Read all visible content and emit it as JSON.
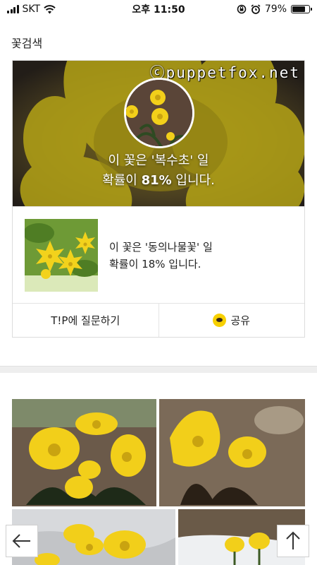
{
  "status_bar": {
    "carrier": "SKT",
    "time": "오후 11:50",
    "battery": "79%",
    "battery_level": 0.79
  },
  "header": {
    "title": "꽃검색"
  },
  "result": {
    "watermark": "ⓒpuppetfox.net",
    "top_line1_prefix": "이 꽃은 '",
    "top_name": "복수초",
    "top_line1_suffix": "' 일",
    "top_line2_prefix": "확률이 ",
    "top_percent": "81%",
    "top_line2_suffix": " 입니다.",
    "second_line1": "이 꽃은 '동의나물꽃' 일",
    "second_line2": "확률이 18% 입니다."
  },
  "actions": {
    "ask_label": "T!P에 질문하기",
    "share_label": "공유"
  },
  "colors": {
    "flower_yellow": "#f2cf1a",
    "kakao_yellow": "#f7d000"
  },
  "icons": [
    "wifi-icon",
    "signal-icon",
    "rotation-lock-icon",
    "alarm-icon",
    "battery-icon",
    "kakaotalk-icon",
    "back-arrow-icon",
    "scroll-top-icon"
  ]
}
